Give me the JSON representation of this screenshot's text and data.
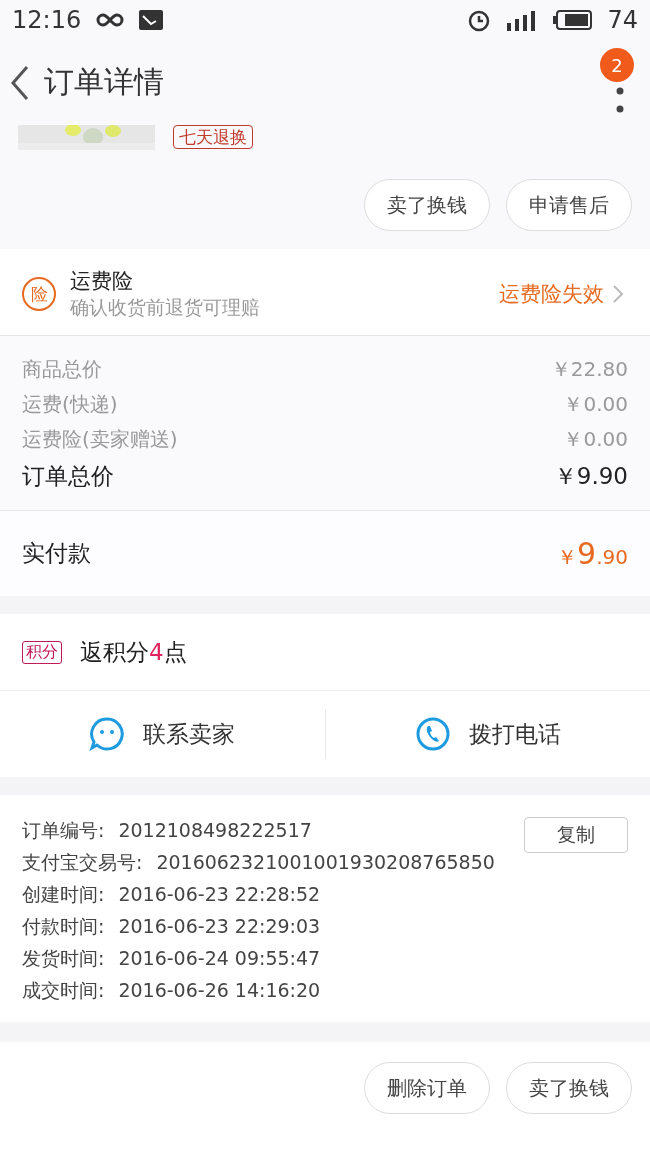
{
  "status_bar": {
    "time": "12:16",
    "battery": "74"
  },
  "header": {
    "title": "订单详情",
    "badge": "2"
  },
  "product": {
    "badge": "七天退换"
  },
  "product_actions": [
    "卖了换钱",
    "申请售后"
  ],
  "insurance": {
    "icon": "险",
    "title": "运费险",
    "subtitle": "确认收货前退货可理赔",
    "status": "运费险失效"
  },
  "prices": [
    {
      "label": "商品总价",
      "value": "￥22.80"
    },
    {
      "label": "运费(快递)",
      "value": "￥0.00"
    },
    {
      "label": "运费险(卖家赠送)",
      "value": "￥0.00"
    }
  ],
  "order_total": {
    "label": "订单总价",
    "value": "￥9.90"
  },
  "paid": {
    "label": "实付款",
    "currency": "￥",
    "integer": "9",
    "decimal": ".90"
  },
  "points": {
    "tag": "积分",
    "text_before": "返积分",
    "amount": "4",
    "text_after": "点"
  },
  "contact": [
    {
      "kind": "chat",
      "label": "联系卖家"
    },
    {
      "kind": "phone",
      "label": "拨打电话"
    }
  ],
  "order_info": {
    "copy_button": "复制",
    "rows": [
      {
        "label": "订单编号:",
        "value": "2012108498222517"
      },
      {
        "label": "支付宝交易号:",
        "value": "2016062321001001930208765850"
      },
      {
        "label": "创建时间:",
        "value": "2016-06-23 22:28:52"
      },
      {
        "label": "付款时间:",
        "value": "2016-06-23 22:29:03"
      },
      {
        "label": "发货时间:",
        "value": "2016-06-24 09:55:47"
      },
      {
        "label": "成交时间:",
        "value": "2016-06-26 14:16:20"
      }
    ]
  },
  "bottom_actions": [
    "删除订单",
    "卖了换钱"
  ]
}
